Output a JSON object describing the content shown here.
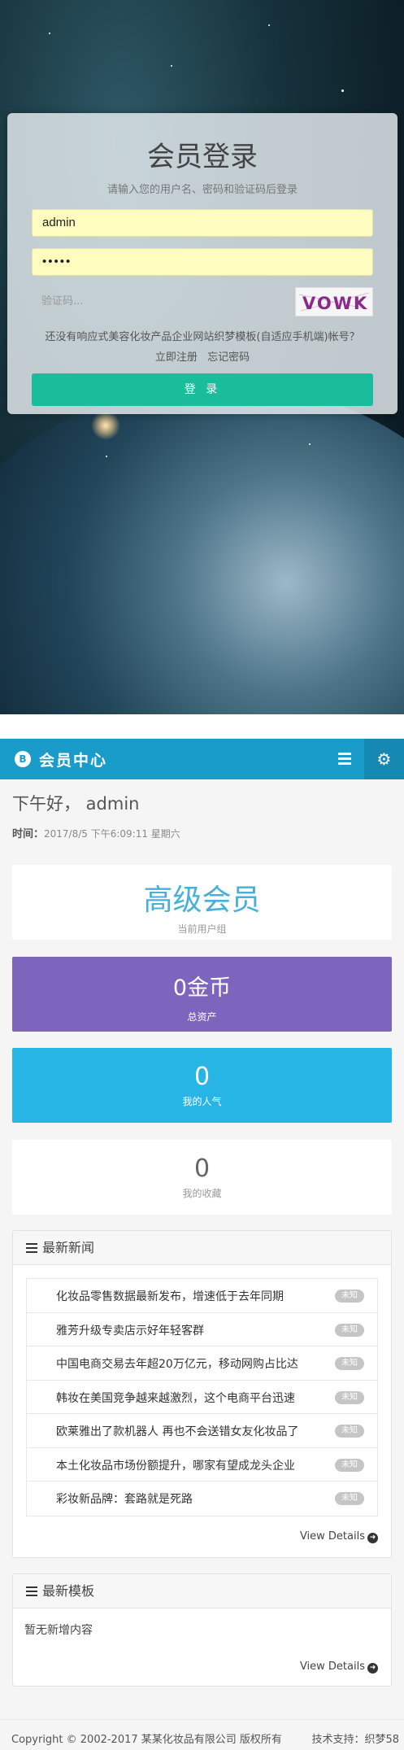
{
  "login": {
    "title": "会员登录",
    "subtitle": "请输入您的用户名、密码和验证码后登录",
    "username_value": "admin",
    "password_value": "•••••",
    "captcha_placeholder": "验证码...",
    "captcha_text": "VOWK",
    "register_question": "还没有响应式美容化妆产品企业网站织梦模板(自适应手机端)帐号？",
    "register_link": "立即注册",
    "forgot_link": "忘记密码",
    "submit_label": "登 录"
  },
  "member": {
    "topbar": {
      "logo_glyph": "B",
      "title": "会员中心",
      "menu_icon": "bars-icon",
      "settings_icon": "gear-icon",
      "settings_glyph": "⚙"
    },
    "greeting": "下午好，  admin",
    "time_label": "时间：",
    "time_value": "2017/8/5 下午6:09:11 星期六",
    "cards": {
      "level": {
        "value": "高级会员",
        "label": "当前用户组"
      },
      "coins": {
        "value": "0金币",
        "label": "总资产"
      },
      "popularity": {
        "value": "0",
        "label": "我的人气"
      },
      "favorites": {
        "value": "0",
        "label": "我的收藏"
      }
    },
    "news": {
      "title": "最新新闻",
      "items": [
        {
          "text": "化妆品零售数据最新发布，增速低于去年同期",
          "badge": "未知"
        },
        {
          "text": "雅芳升级专卖店示好年轻客群",
          "badge": "未知"
        },
        {
          "text": "中国电商交易去年超20万亿元，移动网购占比达",
          "badge": "未知"
        },
        {
          "text": "韩妆在美国竞争越来越激烈，这个电商平台迅速",
          "badge": "未知"
        },
        {
          "text": "欧莱雅出了款机器人 再也不会送错女友化妆品了",
          "badge": "未知"
        },
        {
          "text": "本土化妆品市场份额提升，哪家有望成龙头企业",
          "badge": "未知"
        },
        {
          "text": "彩妆新品牌：套路就是死路",
          "badge": "未知"
        }
      ],
      "view_details": "View Details"
    },
    "templates": {
      "title": "最新模板",
      "empty_text": "暂无新增内容",
      "view_details": "View Details"
    },
    "footer": {
      "copyright": "Copyright © 2002-2017 某某化妆品有限公司 版权所有",
      "support": "技术支持：织梦58"
    }
  },
  "colors": {
    "accent_teal": "#1abc9c",
    "topbar_blue": "#199cc9",
    "coins_purple": "#7d64bd",
    "popularity_blue": "#26b5e5",
    "level_text": "#48b0d8"
  }
}
